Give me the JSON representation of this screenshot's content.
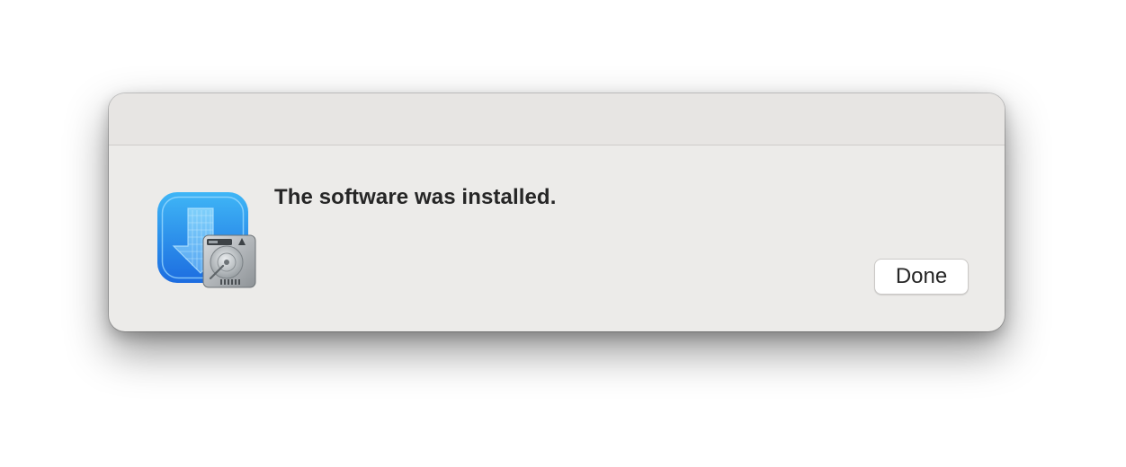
{
  "dialog": {
    "message": "The software was installed.",
    "done_label": "Done"
  },
  "icons": {
    "app_icon": "installer-download-arrow-icon",
    "badge_icon": "hard-disk-drive-icon"
  },
  "colors": {
    "dialog_background": "#ecebe9",
    "titlebar_background": "#e7e5e3",
    "icon_blue_top": "#3fb2f5",
    "icon_blue_bottom": "#1e6fe0",
    "button_background": "#ffffff",
    "text": "#262626"
  }
}
